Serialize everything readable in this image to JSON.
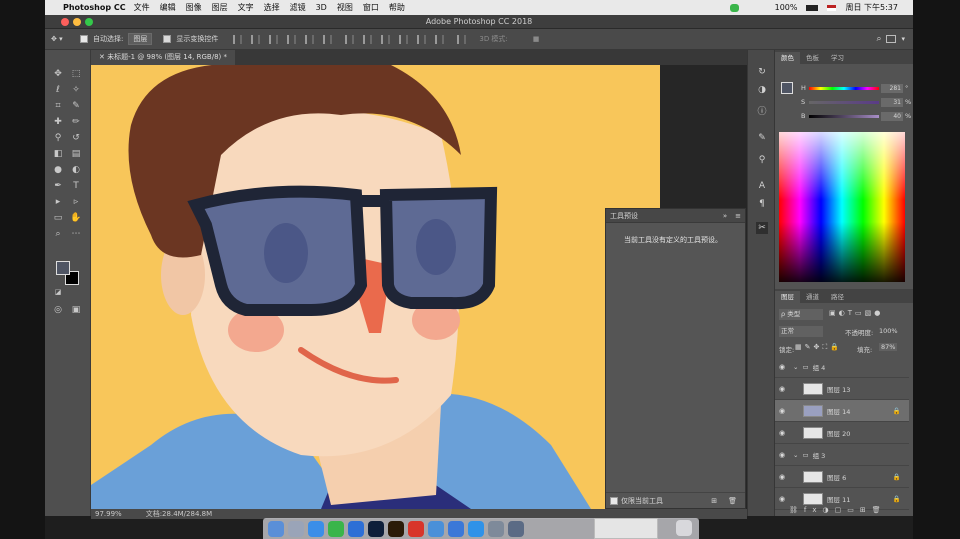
{
  "menubar": {
    "app_name": "Photoshop CC",
    "items": [
      "文件",
      "编辑",
      "图像",
      "图层",
      "文字",
      "选择",
      "滤镜",
      "3D",
      "视图",
      "窗口",
      "帮助"
    ],
    "battery": "100%",
    "clock": "周日 下午5:37"
  },
  "window_title": "Adobe Photoshop CC 2018",
  "options_bar": {
    "auto_select_label": "自动选择:",
    "auto_select_value": "图层",
    "show_transform_label": "显示变换控件",
    "mode_3d_label": "3D 模式:"
  },
  "document_tab": "未标题-1 @ 98% (图层 14, RGB/8) *",
  "tool_presets_panel": {
    "title": "工具预设",
    "message": "当前工具没有定义的工具预设。",
    "footer_label": "仅限当前工具"
  },
  "status_bar": {
    "zoom": "97.99%",
    "doc_info": "文档:28.4M/284.8M"
  },
  "color_panel": {
    "tabs": [
      "颜色",
      "色板",
      "学习"
    ],
    "sliders": [
      {
        "label": "H",
        "value": "281",
        "unit": "°"
      },
      {
        "label": "S",
        "value": "31",
        "unit": "%"
      },
      {
        "label": "B",
        "value": "40",
        "unit": "%"
      }
    ]
  },
  "layers_panel": {
    "tabs": [
      "图层",
      "通道",
      "路径"
    ],
    "filter_kind": "ρ 类型",
    "blend_mode": "正常",
    "opacity_label": "不透明度:",
    "opacity_value": "100%",
    "lock_label": "锁定:",
    "fill_label": "填充:",
    "fill_value": "87%",
    "layers": [
      {
        "name": "组 4",
        "type": "group"
      },
      {
        "name": "图层 13",
        "type": "layer"
      },
      {
        "name": "图层 14",
        "type": "layer",
        "selected": true
      },
      {
        "name": "图层 20",
        "type": "layer"
      },
      {
        "name": "组 3",
        "type": "group"
      },
      {
        "name": "图层 6",
        "type": "layer"
      },
      {
        "name": "图层 11",
        "type": "layer"
      }
    ]
  },
  "colors": {
    "foreground": "#4f5564",
    "background": "#000000",
    "canvas_bg": "#f8c65a",
    "ui_dark": "#535353"
  }
}
